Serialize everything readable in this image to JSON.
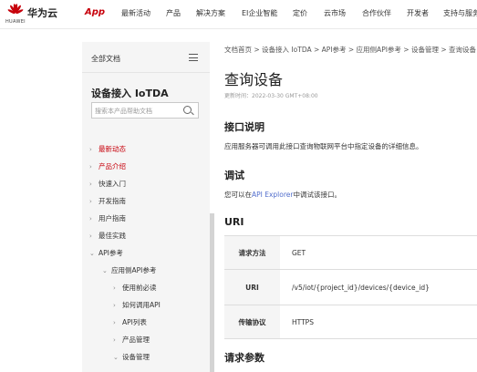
{
  "header": {
    "brand": "华为云",
    "brand_sub": "HUAWEI",
    "app_label": "App",
    "nav_items": [
      "最新活动",
      "产品",
      "解决方案",
      "EI企业智能",
      "定价",
      "云市场",
      "合作伙伴",
      "开发者",
      "支持与服务"
    ],
    "accent": "#c7000b"
  },
  "sidebar": {
    "all_docs": "全部文档",
    "title": "设备接入 IoTDA",
    "search_placeholder": "搜索本产品帮助文档",
    "items": [
      {
        "label": "最新动态",
        "chevron": "›",
        "active": true
      },
      {
        "label": "产品介绍",
        "chevron": "›",
        "active": true
      },
      {
        "label": "快速入门",
        "chevron": "›"
      },
      {
        "label": "开发指南",
        "chevron": "›"
      },
      {
        "label": "用户指南",
        "chevron": "›"
      },
      {
        "label": "最佳实践",
        "chevron": "›"
      },
      {
        "label": "API参考",
        "chevron": "⌄"
      },
      {
        "label": "应用侧API参考",
        "chevron": "⌄"
      },
      {
        "label": "使用前必读",
        "chevron": "›"
      },
      {
        "label": "如何调用API",
        "chevron": "›"
      },
      {
        "label": "API列表",
        "chevron": "›"
      },
      {
        "label": "产品管理",
        "chevron": "›"
      },
      {
        "label": "设备管理",
        "chevron": "⌄"
      }
    ]
  },
  "main": {
    "breadcrumb": "文档首页 > 设备接入 IoTDA > API参考 > 应用侧API参考 > 设备管理 > 查询设备",
    "title": "查询设备",
    "updated": "更新时间：2022-03-30 GMT+08:00",
    "sec_interface": "接口说明",
    "interface_desc": "应用服务器可调用此接口查询物联网平台中指定设备的详细信息。",
    "sec_debug": "调试",
    "debug_prefix": "您可以在",
    "debug_link": "API Explorer",
    "debug_suffix": "中调试该接口。",
    "sec_uri": "URI",
    "table": [
      {
        "key": "请求方法",
        "value": "GET"
      },
      {
        "key": "URI",
        "value": "/v5/iot/{project_id}/devices/{device_id}"
      },
      {
        "key": "传输协议",
        "value": "HTTPS"
      }
    ],
    "sec_params": "请求参数"
  }
}
